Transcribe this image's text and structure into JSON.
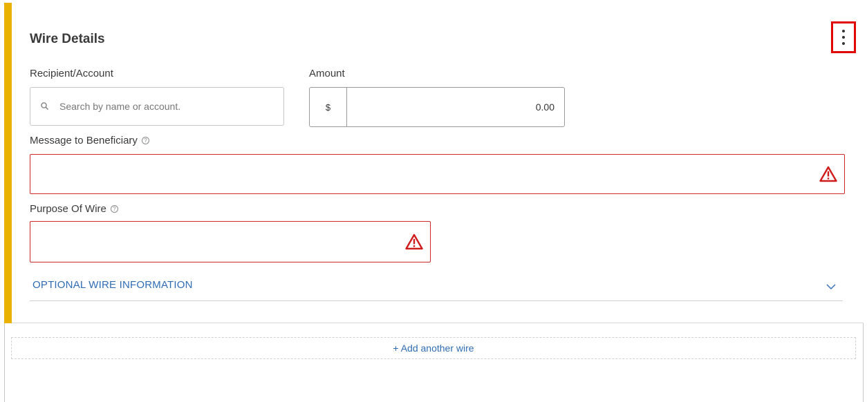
{
  "card": {
    "title": "Wire Details",
    "accent_color": "#e9b200",
    "more_options_icon": "vertical-dots-icon"
  },
  "fields": {
    "recipient": {
      "label": "Recipient/Account",
      "placeholder": "Search by name or account.",
      "value": "",
      "icon": "search-icon"
    },
    "amount": {
      "label": "Amount",
      "currency_symbol": "$",
      "value": "0.00"
    },
    "message": {
      "label": "Message to Beneficiary",
      "help_icon": "question-circle-icon",
      "value": "",
      "error_icon": "warning-triangle-icon"
    },
    "purpose": {
      "label": "Purpose Of Wire",
      "help_icon": "question-circle-icon",
      "value": "",
      "error_icon": "warning-triangle-icon"
    }
  },
  "optional_section": {
    "label": "OPTIONAL WIRE INFORMATION",
    "icon": "chevron-down-icon"
  },
  "add_wire": {
    "label": "+ Add another wire"
  },
  "colors": {
    "error_border": "#cc2a2a",
    "error_icon": "#d01b1b",
    "link_blue": "#2e6db4",
    "highlight_box": "#e00000"
  }
}
